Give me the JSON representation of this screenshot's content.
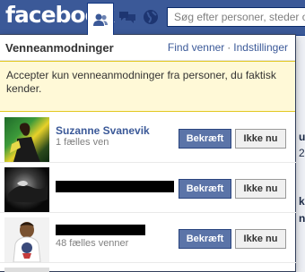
{
  "header": {
    "logo": "facebook",
    "search_placeholder": "Søg efter personer, steder og ting"
  },
  "flyout": {
    "title": "Venneanmodninger",
    "find_friends": "Find venner",
    "separator": "·",
    "settings": "Indstillinger",
    "notice": "Accepter kun venneanmodninger fra personer, du faktisk kender."
  },
  "requests": [
    {
      "name": "Suzanne Svanevik",
      "mutual": "1 fælles ven",
      "confirm": "Bekræft",
      "ignore": "Ikke nu"
    },
    {
      "name": "",
      "mutual": "",
      "confirm": "Bekræft",
      "ignore": "Ikke nu"
    },
    {
      "name": "",
      "mutual": "48 fælles venner",
      "confirm": "Bekræft",
      "ignore": "Ikke nu"
    }
  ],
  "background_fragments": [
    "ug",
    "2",
    "k",
    "n"
  ],
  "colors": {
    "brand": "#3b5998",
    "notice_bg": "#fff9d7",
    "confirm_bg": "#5b74a8"
  }
}
